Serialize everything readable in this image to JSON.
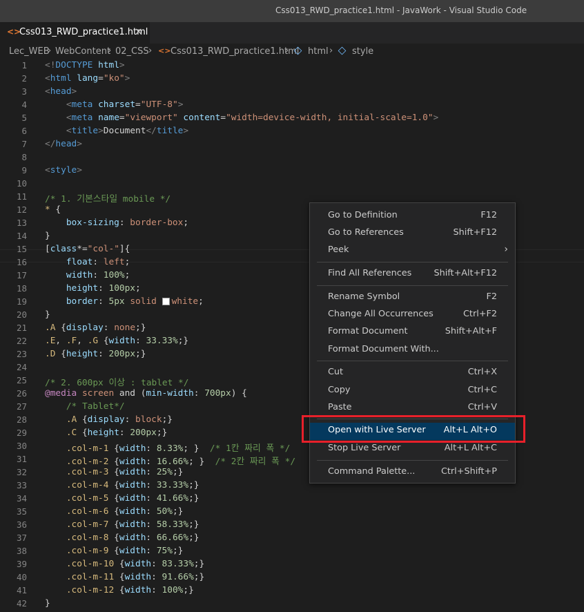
{
  "window": {
    "title": "Css013_RWD_practice1.html - JavaWork - Visual Studio Code"
  },
  "tab": {
    "icon": "html-file-icon",
    "label": "Css013_RWD_practice1.html",
    "close": "×"
  },
  "breadcrumb": [
    "Lec_WEB",
    "WebContent",
    "02_CSS",
    "Css013_RWD_practice1.html",
    "html",
    "style"
  ],
  "code": {
    "line_numbers": [
      "1",
      "2",
      "3",
      "4",
      "5",
      "6",
      "7",
      "8",
      "9",
      "10",
      "11",
      "12",
      "13",
      "14",
      "15",
      "16",
      "17",
      "18",
      "19",
      "20",
      "21",
      "22",
      "23",
      "24",
      "25",
      "26",
      "27",
      "28",
      "29",
      "30",
      "31",
      "32",
      "33",
      "34",
      "35",
      "36",
      "37",
      "38",
      "39",
      "40",
      "41",
      "42"
    ]
  },
  "context_menu": {
    "items": [
      {
        "label": "Go to Definition",
        "key": "F12"
      },
      {
        "label": "Go to References",
        "key": "Shift+F12"
      },
      {
        "label": "Peek",
        "key": "",
        "submenu": "›"
      },
      {
        "label": "Find All References",
        "key": "Shift+Alt+F12"
      },
      {
        "label": "Rename Symbol",
        "key": "F2"
      },
      {
        "label": "Change All Occurrences",
        "key": "Ctrl+F2"
      },
      {
        "label": "Format Document",
        "key": "Shift+Alt+F"
      },
      {
        "label": "Format Document With...",
        "key": ""
      },
      {
        "label": "Cut",
        "key": "Ctrl+X"
      },
      {
        "label": "Copy",
        "key": "Ctrl+C"
      },
      {
        "label": "Paste",
        "key": "Ctrl+V"
      },
      {
        "label": "Open with Live Server",
        "key": "Alt+L Alt+O"
      },
      {
        "label": "Stop Live Server",
        "key": "Alt+L Alt+C"
      },
      {
        "label": "Command Palette...",
        "key": "Ctrl+Shift+P"
      }
    ],
    "active_item": "Open with Live Server"
  },
  "colors": {
    "editor_bg": "#1e1e1e",
    "menu_bg": "#252526",
    "menu_active": "#04395e",
    "highlight_box": "#e8202a"
  }
}
